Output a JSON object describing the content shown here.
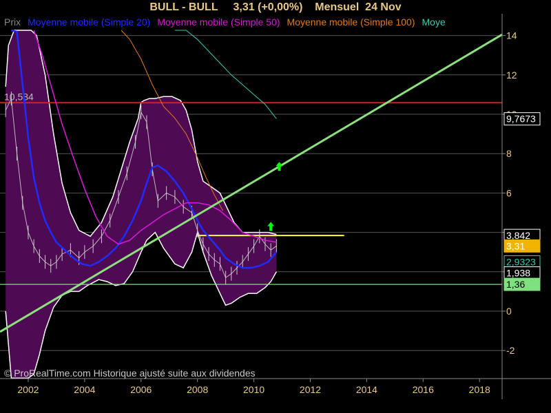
{
  "header": {
    "title": "BULL - BULL     3,31 (+0,00%)    Mensuel  24 Nov"
  },
  "legend": [
    {
      "label": "Prix",
      "color": "#888888"
    },
    {
      "label": "Moyenne mobile (Simple 20)",
      "color": "#1e2cff"
    },
    {
      "label": "Moyenne mobile (Simple 50)",
      "color": "#d21ad2"
    },
    {
      "label": "Moyenne mobile (Simple 100)",
      "color": "#e07a1e"
    },
    {
      "label": "Moye",
      "color": "#3fc6b0"
    }
  ],
  "footer": {
    "copyright": "© ProRealTime.com Historique ajusté suite aux dividendes"
  },
  "chart_data": {
    "type": "line",
    "frequency": "monthly",
    "xlim": [
      2001.0,
      2018.8
    ],
    "ylim": [
      -3.4,
      15.0
    ],
    "x_ticks": [
      "2002",
      "2004",
      "2006",
      "2008",
      "2010",
      "2012",
      "2014",
      "2016",
      "2018"
    ],
    "y_ticks": [
      "-2",
      "0",
      "2",
      "4",
      "6",
      "8",
      "10",
      "12",
      "14"
    ],
    "colors": {
      "background": "#000000",
      "band_fill": "#4e0a52",
      "band_edge": "#ffffff",
      "price": "#cccccc",
      "sma20": "#1e2cff",
      "sma50": "#d21ad2",
      "sma100": "#e07a1e",
      "sma200": "#3fc6b0",
      "resistance": "#d32020",
      "support": "#7ee07e",
      "trendline": "#8ce07e",
      "recent_level": "#ffff33",
      "signal": "#00ff00",
      "axis_text": "#e8c98a",
      "grid": "#555555"
    },
    "price": {
      "x": [
        2001.2,
        2001.4,
        2001.6,
        2001.8,
        2002.0,
        2002.2,
        2002.4,
        2002.6,
        2002.8,
        2003.0,
        2003.2,
        2003.5,
        2003.8,
        2004.0,
        2004.3,
        2004.6,
        2004.9,
        2005.2,
        2005.5,
        2005.8,
        2006.0,
        2006.2,
        2006.4,
        2006.6,
        2006.9,
        2007.2,
        2007.5,
        2007.8,
        2008.0,
        2008.2,
        2008.4,
        2008.6,
        2008.8,
        2009.0,
        2009.2,
        2009.4,
        2009.6,
        2009.8,
        2010.0,
        2010.2,
        2010.4,
        2010.6,
        2010.8
      ],
      "y": [
        10.2,
        10.8,
        8.0,
        5.5,
        4.0,
        3.3,
        2.8,
        2.5,
        2.3,
        2.5,
        2.9,
        3.1,
        2.7,
        3.0,
        3.3,
        3.8,
        4.6,
        5.8,
        7.0,
        8.6,
        10.1,
        9.6,
        7.2,
        5.6,
        6.0,
        5.8,
        5.3,
        5.0,
        4.1,
        3.4,
        2.9,
        2.6,
        2.4,
        1.7,
        1.9,
        2.2,
        2.5,
        2.9,
        3.3,
        3.8,
        3.4,
        3.1,
        3.31
      ]
    },
    "bollinger_upper": {
      "x": [
        2001.2,
        2001.3,
        2001.5,
        2001.7,
        2001.9,
        2002.1,
        2002.3,
        2002.6,
        2002.9,
        2003.2,
        2003.5,
        2003.8,
        2004.2,
        2004.6,
        2005.0,
        2005.3,
        2005.6,
        2005.9,
        2006.0,
        2006.1,
        2006.3,
        2006.5,
        2006.8,
        2007.1,
        2007.4,
        2007.6,
        2007.8,
        2008.0,
        2008.2,
        2008.5,
        2008.8,
        2009.0,
        2009.3,
        2009.6,
        2009.9,
        2010.2,
        2010.5,
        2010.8
      ],
      "y": [
        11.4,
        13.5,
        15.0,
        15.0,
        15.0,
        15.0,
        14.0,
        12.0,
        9.0,
        6.5,
        5.0,
        4.1,
        3.8,
        4.5,
        5.8,
        7.2,
        8.6,
        9.8,
        10.6,
        10.7,
        10.8,
        10.8,
        10.9,
        10.9,
        10.7,
        10.2,
        9.2,
        7.6,
        6.6,
        6.3,
        6.0,
        5.4,
        4.5,
        4.0,
        4.0,
        4.0,
        4.0,
        3.9
      ]
    },
    "bollinger_lower": {
      "x": [
        2001.2,
        2001.4,
        2001.6,
        2001.8,
        2002.0,
        2002.2,
        2002.4,
        2002.6,
        2002.9,
        2003.2,
        2003.5,
        2003.8,
        2004.1,
        2004.5,
        2004.8,
        2005.1,
        2005.4,
        2005.7,
        2006.0,
        2006.2,
        2006.5,
        2006.8,
        2007.2,
        2007.5,
        2007.8,
        2008.0,
        2008.2,
        2008.5,
        2008.8,
        2009.0,
        2009.2,
        2009.5,
        2009.8,
        2010.1,
        2010.4,
        2010.6,
        2010.8
      ],
      "y": [
        0.0,
        -3.4,
        -3.4,
        -3.4,
        -3.4,
        -3.2,
        -2.2,
        -1.0,
        0.2,
        0.8,
        1.0,
        1.0,
        1.3,
        1.6,
        1.5,
        1.3,
        1.4,
        2.0,
        3.0,
        3.6,
        4.0,
        3.2,
        2.4,
        2.2,
        3.0,
        4.0,
        3.0,
        1.8,
        0.9,
        0.3,
        0.4,
        0.7,
        0.9,
        0.9,
        1.2,
        1.5,
        2.0
      ]
    },
    "series": [
      {
        "name": "Moyenne mobile (Simple 20)",
        "key": "sma20",
        "x": [
          2001.4,
          2001.6,
          2001.8,
          2002.0,
          2002.2,
          2002.4,
          2002.6,
          2002.8,
          2003.0,
          2003.3,
          2003.6,
          2003.9,
          2004.2,
          2004.5,
          2004.8,
          2005.1,
          2005.4,
          2005.7,
          2006.0,
          2006.2,
          2006.4,
          2006.6,
          2006.9,
          2007.2,
          2007.5,
          2007.8,
          2008.0,
          2008.2,
          2008.5,
          2008.8,
          2009.0,
          2009.3,
          2009.6,
          2009.9,
          2010.2,
          2010.5,
          2010.8
        ],
        "y": [
          15.0,
          14.2,
          11.5,
          8.8,
          6.8,
          5.5,
          4.6,
          4.0,
          3.5,
          3.1,
          2.7,
          2.4,
          2.3,
          2.5,
          2.8,
          3.2,
          3.8,
          4.6,
          5.6,
          6.5,
          7.3,
          7.4,
          7.1,
          6.6,
          6.0,
          5.2,
          4.6,
          4.1,
          3.6,
          3.1,
          2.7,
          2.4,
          2.2,
          2.2,
          2.3,
          2.5,
          3.0
        ]
      },
      {
        "name": "Moyenne mobile (Simple 50)",
        "key": "sma50",
        "x": [
          2002.2,
          2002.5,
          2002.8,
          2003.2,
          2003.6,
          2004.0,
          2004.4,
          2004.8,
          2005.2,
          2005.6,
          2006.0,
          2006.4,
          2006.8,
          2007.2,
          2007.6,
          2008.0,
          2008.4,
          2008.8,
          2009.2,
          2009.6,
          2010.0,
          2010.4,
          2010.8
        ],
        "y": [
          15.0,
          13.0,
          11.5,
          9.5,
          7.8,
          6.2,
          4.8,
          3.8,
          3.4,
          3.6,
          4.1,
          4.5,
          4.9,
          5.2,
          5.5,
          5.5,
          5.4,
          5.1,
          4.6,
          4.0,
          3.8,
          3.6,
          3.5
        ]
      },
      {
        "name": "Moyenne mobile (Simple 100)",
        "key": "sma100",
        "x": [
          2005.3,
          2005.6,
          2006.0,
          2006.4,
          2006.8,
          2007.2,
          2007.6,
          2008.0,
          2008.3,
          2008.6,
          2008.9
        ],
        "y": [
          14.6,
          13.8,
          12.8,
          11.5,
          10.4,
          9.8,
          9.0,
          7.8,
          6.8,
          5.9,
          5.1
        ]
      },
      {
        "name": "Moye",
        "key": "sma200",
        "x": [
          2007.2,
          2007.6,
          2008.0,
          2008.4,
          2008.8,
          2009.2,
          2009.6,
          2010.0,
          2010.4,
          2010.8
        ],
        "y": [
          15.0,
          14.4,
          13.8,
          13.2,
          12.6,
          12.0,
          11.5,
          11.0,
          10.5,
          9.77
        ]
      }
    ],
    "levels": [
      {
        "label": "10,584",
        "value": 10.584,
        "key": "resistance"
      },
      {
        "label": "1,36",
        "value": 1.36,
        "key": "support"
      }
    ],
    "recent_level": {
      "value": 3.842,
      "x_start": 2008.0,
      "x_end": 2013.2
    },
    "trendline": {
      "x": [
        2001.0,
        2018.8
      ],
      "y": [
        -1.05,
        14.05
      ]
    },
    "signals": [
      {
        "x": 2010.6,
        "y": 4.25
      },
      {
        "x": 2010.9,
        "y": 7.3
      }
    ],
    "price_labels": [
      {
        "text": "9,7673",
        "value": 9.767,
        "fill": "#000000",
        "text_color": "#ffffff",
        "border": "#ffffff"
      },
      {
        "text": "3,842",
        "value": 3.842,
        "fill": "#000000",
        "text_color": "#ffffff",
        "border": "#ffffff"
      },
      {
        "text": "3,31",
        "value": 3.31,
        "fill": "#f0b400",
        "text_color": "#ffffff",
        "border": "#f0b400"
      },
      {
        "text": "2,9323",
        "value": 2.5,
        "fill": "#000000",
        "text_color": "#3fc6b0",
        "border": "#3fc6b0"
      },
      {
        "text": "1,938",
        "value": 1.938,
        "fill": "#000000",
        "text_color": "#ffffff",
        "border": "#ffffff"
      },
      {
        "text": "1,36",
        "value": 1.36,
        "fill": "#7ee07e",
        "text_color": "#000000",
        "border": "#7ee07e"
      }
    ]
  }
}
